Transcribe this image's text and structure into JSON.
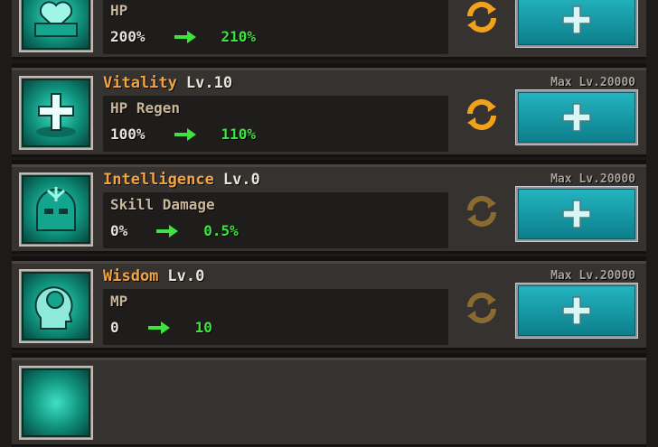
{
  "stats": [
    {
      "name": "",
      "level": "",
      "max_level": "",
      "effect": "HP",
      "current": "200%",
      "next": "210%",
      "cycle_active": true,
      "icon": "heart-armor-icon"
    },
    {
      "name": "Vitality",
      "level": "Lv.10",
      "max_level": "Max Lv.20000",
      "effect": "HP Regen",
      "current": "100%",
      "next": "110%",
      "cycle_active": true,
      "icon": "holy-cross-icon"
    },
    {
      "name": "Intelligence",
      "level": "Lv.0",
      "max_level": "Max Lv.20000",
      "effect": "Skill Damage",
      "current": "0%",
      "next": "0.5%",
      "cycle_active": false,
      "icon": "ornate-helmet-icon"
    },
    {
      "name": "Wisdom",
      "level": "Lv.0",
      "max_level": "Max Lv.20000",
      "effect": "MP",
      "current": "0",
      "next": "10",
      "cycle_active": false,
      "icon": "brain-head-icon"
    },
    {
      "name": "",
      "level": "",
      "max_level": "",
      "effect": "",
      "current": "",
      "next": "",
      "cycle_active": false,
      "icon": "teal-icon"
    }
  ],
  "colors": {
    "stat_name": "#f2a445",
    "next_value": "#3fe23f",
    "cycle_active": "#f0a21d",
    "cycle_inactive": "#8a6a2e",
    "plus_button": "#179aa6"
  }
}
